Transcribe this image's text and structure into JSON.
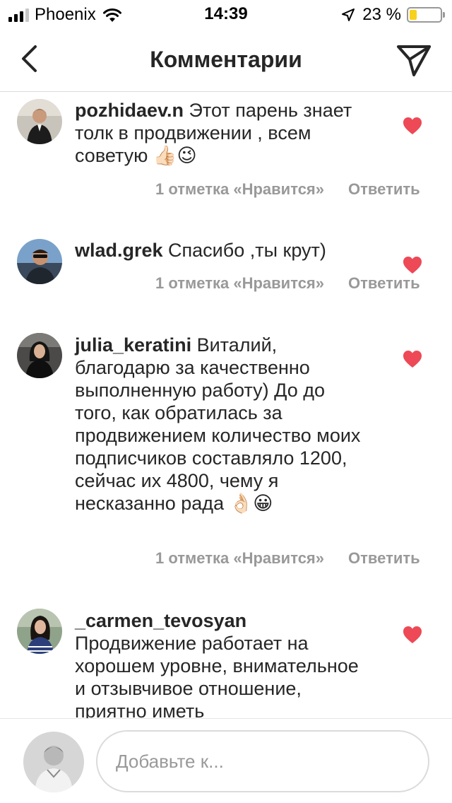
{
  "status_bar": {
    "carrier": "Phoenix",
    "time": "14:39",
    "battery": "23 %",
    "battery_level": 0.23
  },
  "header": {
    "title": "Комментарии",
    "back_icon": "chevron-left-icon",
    "send_icon": "paper-plane-icon"
  },
  "comments": [
    {
      "username": "pozhidaev.n",
      "text": " Этот парень знает толк в продвижении , всем советую 👍🏻😉",
      "likes": "1 отметка «Нравится»",
      "reply": "Ответить",
      "liked": true
    },
    {
      "username": "wlad.grek",
      "text": " Спасибо ,ты крут)",
      "likes": "1 отметка «Нравится»",
      "reply": "Ответить",
      "liked": true
    },
    {
      "username": "julia_keratini",
      "text": " Виталий, благодарю за качественно выполненную работу) До до того, как обратилась за продвижением количество моих подписчиков составляло 1200, сейчас их 4800, чему я несказанно рада 👌🏻😀",
      "likes": "1 отметка «Нравится»",
      "reply": "Ответить",
      "liked": true
    },
    {
      "username": "_carmen_tevosyan",
      "text": "Продвижение работает на хорошем уровне, внимательное  и отзывчивое отношение, приятно иметь",
      "likes": "",
      "reply": "",
      "liked": true
    }
  ],
  "composer": {
    "placeholder": "Добавьте к..."
  },
  "colors": {
    "heart": "#ed4956",
    "meta_text": "#999999",
    "text": "#262626",
    "battery": "#f7d11d"
  }
}
